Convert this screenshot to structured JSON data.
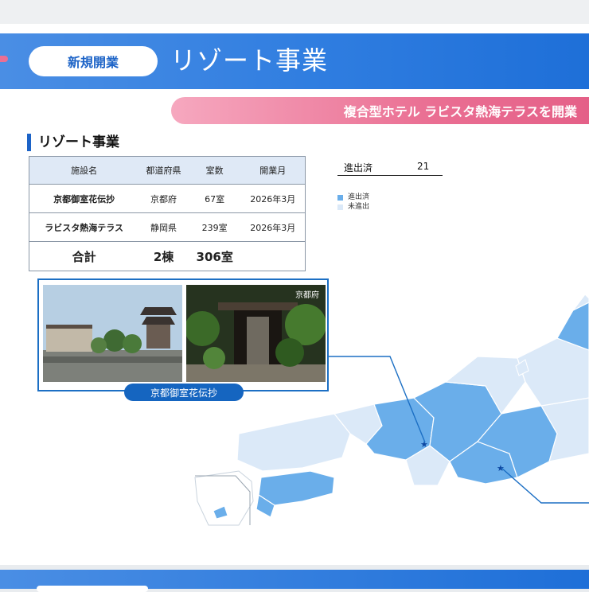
{
  "header": {
    "category_pill": "新規開業",
    "title": "リゾート事業",
    "announcement": "複合型ホテル ラビスタ熱海テラスを開業"
  },
  "section": {
    "title": "リゾート事業"
  },
  "table": {
    "headers": [
      "施設名",
      "都道府県",
      "室数",
      "開業月"
    ],
    "rows": [
      [
        "京都御室花伝抄",
        "京都府",
        "67室",
        "2026年3月"
      ],
      [
        "ラビスタ熱海テラス",
        "静岡県",
        "239室",
        "2026年3月"
      ]
    ],
    "total": {
      "label": "合計",
      "buildings": "2棟",
      "rooms": "306室"
    }
  },
  "stats": {
    "label": "進出済",
    "value": "21"
  },
  "legend": [
    {
      "label": "進出済",
      "color": "#6aaeea"
    },
    {
      "label": "未進出",
      "color": "#dbe9f8"
    }
  ],
  "photo_panel": {
    "tag": "京都府",
    "caption": "京都御室花伝抄"
  },
  "colors": {
    "accent_blue": "#1c63c7",
    "pink": "#ea6f93",
    "entered": "#6aaeea",
    "not_entered": "#dbe9f8"
  }
}
